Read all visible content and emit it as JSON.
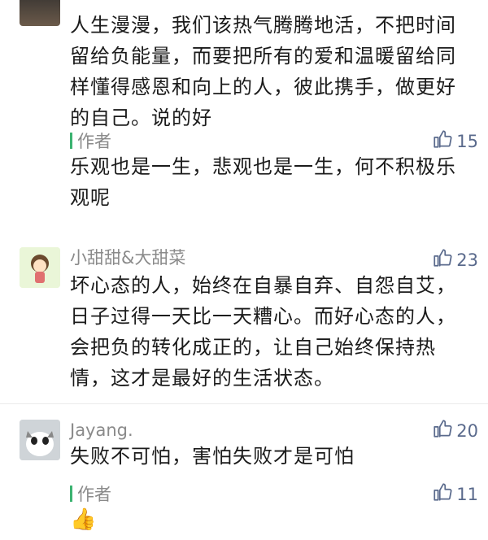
{
  "comments": [
    {
      "name": "",
      "text": "人生漫漫，我们该热气腾腾地活，不把时间\n留给负能量，而要把所有的爱和温暖留给同\n样懂得感恩和向上的人，彼此携手，做更好\n的自己。说的好",
      "reply_label": "作者",
      "reply_likes": "15",
      "reply_text": "乐观也是一生，悲观也是一生，何不积极乐\n观呢"
    },
    {
      "name": "小甜甜&大甜菜",
      "likes": "23",
      "text": "坏心态的人，始终在自暴自弃、自怨自艾，\n日子过得一天比一天糟心。而好心态的人，\n会把负的转化成正的，让自己始终保持热\n情，这才是最好的生活状态。"
    },
    {
      "name": "Jayang.",
      "likes": "20",
      "text": "失败不可怕，害怕失败才是可怕",
      "reply_label": "作者",
      "reply_likes": "11",
      "reply_emoji": "👍"
    }
  ],
  "icons": {
    "like": "thumbs-up-icon"
  },
  "colors": {
    "author_bar": "#3cb371",
    "like": "#5a6a8c",
    "name": "#8a8a8a"
  }
}
